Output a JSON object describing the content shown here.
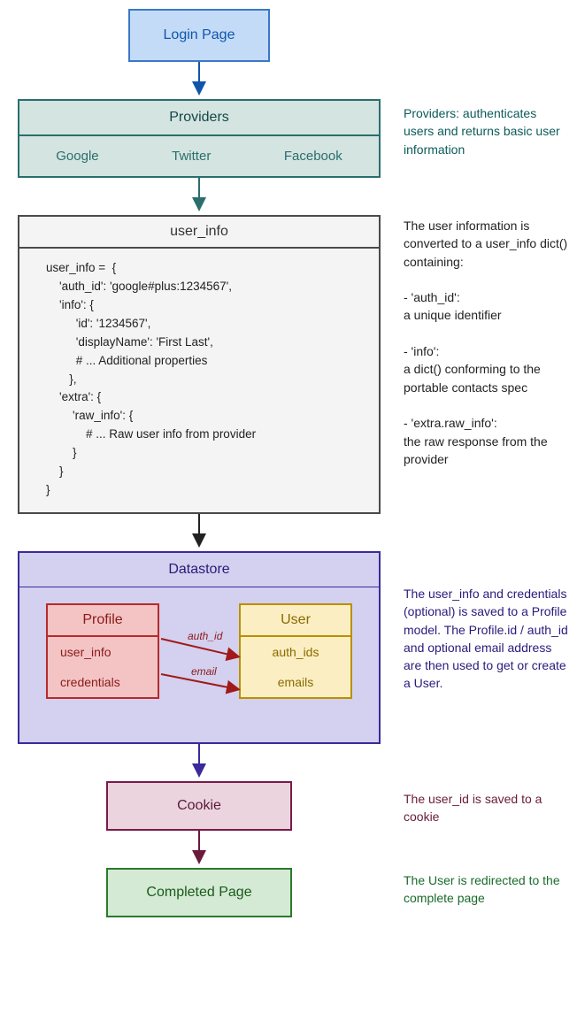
{
  "login": {
    "label": "Login Page"
  },
  "providers": {
    "title": "Providers",
    "items": [
      "Google",
      "Twitter",
      "Facebook"
    ],
    "note": "Providers: authenticates users and returns basic user information"
  },
  "user_info": {
    "title": "user_info",
    "code": "user_info =  {\n    'auth_id': 'google#plus:1234567',\n    'info': {\n         'id': '1234567',\n         'displayName': 'First Last',\n         # ... Additional properties\n       },\n    'extra': {\n        'raw_info': {\n            # ... Raw user info from provider\n        }\n    }\n}",
    "note": "The user information is converted to a user_info dict() containing:\n\n- 'auth_id':\na unique identifier\n\n- 'info':\na dict() conforming to the portable contacts spec\n\n- 'extra.raw_info':\nthe raw response from the provider"
  },
  "datastore": {
    "title": "Datastore",
    "profile": {
      "title": "Profile",
      "fields": [
        "user_info",
        "credentials"
      ]
    },
    "user": {
      "title": "User",
      "fields": [
        "auth_ids",
        "emails"
      ]
    },
    "edges": {
      "auth_id": "auth_id",
      "email": "email"
    },
    "note": "The user_info and credentials (optional) is saved to a Profile model. The Profile.id / auth_id and optional email address are then used to get or create a User."
  },
  "cookie": {
    "label": "Cookie",
    "note": "The user_id is saved to a cookie"
  },
  "completed": {
    "label": "Completed Page",
    "note": "The User is redirected to the complete page"
  },
  "arrow_colors": {
    "login": "#1155aa",
    "providers": "#2a6e6e",
    "userinfo": "#222222",
    "datastore": "#3a2a9a",
    "cookie": "#6a1a3a",
    "ds_link": "#a01a1a"
  }
}
